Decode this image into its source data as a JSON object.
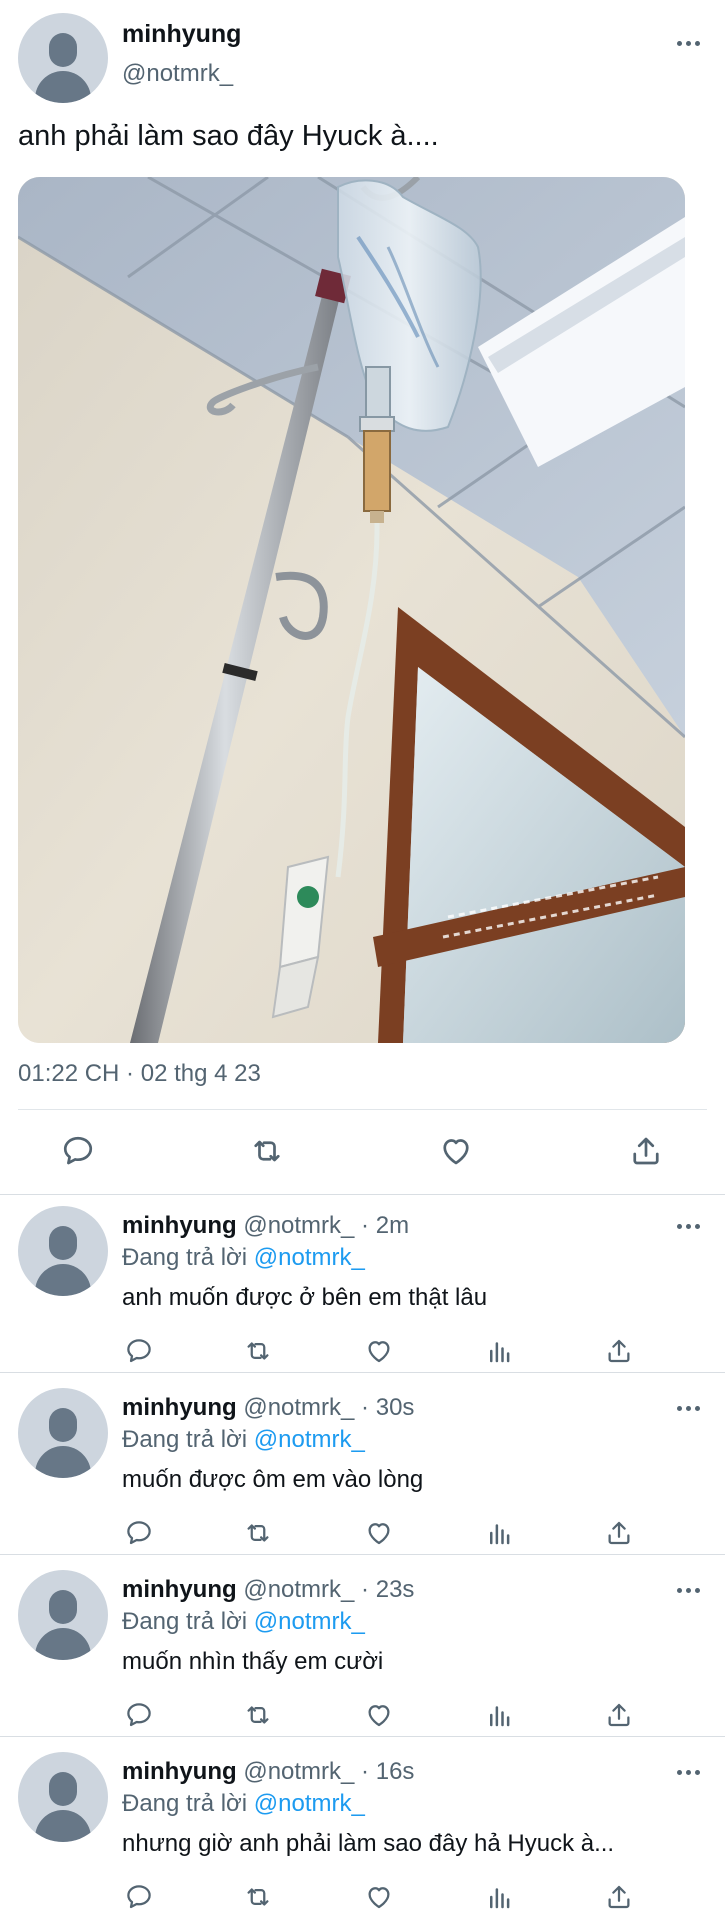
{
  "tweet": {
    "display_name": "minhyung",
    "handle": "@notmrk_",
    "text": "anh phải làm sao đây Hyuck à....",
    "timestamp": "01:22 CH · 02 thg 4 23",
    "image_icon": "iv-drip-photo"
  },
  "icons": {
    "reply": "speech-bubble-icon",
    "retweet": "retweet-icon",
    "like": "heart-icon",
    "views": "bar-chart-icon",
    "share": "share-upload-icon",
    "more": "more-dots-icon"
  },
  "colors": {
    "text": "#0f1419",
    "secondary": "#536471",
    "link": "#1d9bf0",
    "divider": "#e1e6ea"
  },
  "replies": [
    {
      "display_name": "minhyung",
      "meta": "@notmrk_ · 2m",
      "replying_prefix": "Đang trả lời",
      "replying_to": "@notmrk_",
      "text": "anh muốn được ở bên em thật lâu"
    },
    {
      "display_name": "minhyung",
      "meta": "@notmrk_ · 30s",
      "replying_prefix": "Đang trả lời",
      "replying_to": "@notmrk_",
      "text": "muốn được ôm em vào lòng"
    },
    {
      "display_name": "minhyung",
      "meta": "@notmrk_ · 23s",
      "replying_prefix": "Đang trả lời",
      "replying_to": "@notmrk_",
      "text": "muốn nhìn thấy em cười"
    },
    {
      "display_name": "minhyung",
      "meta": "@notmrk_ · 16s",
      "replying_prefix": "Đang trả lời",
      "replying_to": "@notmrk_",
      "text": "nhưng giờ anh phải làm sao đây hả Hyuck à..."
    }
  ]
}
